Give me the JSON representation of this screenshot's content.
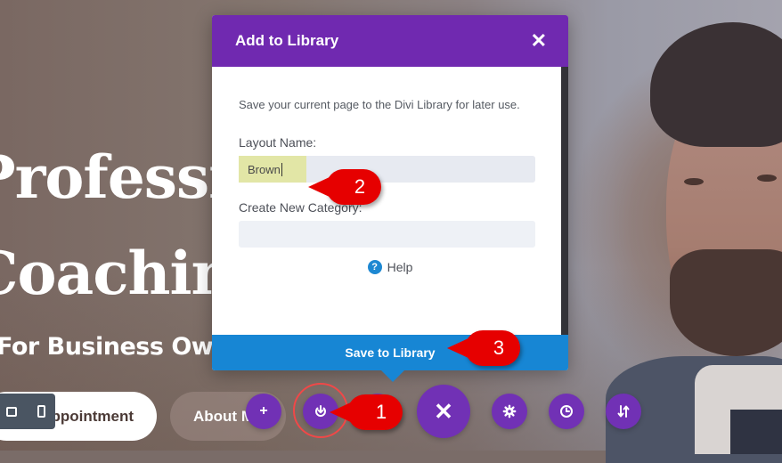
{
  "hero": {
    "title_line1": "Professional",
    "title_line2": "Coaching",
    "subtitle": "For Business Owners",
    "cta_primary": "Book Appointment",
    "cta_secondary": "About Me"
  },
  "device_bar": {
    "icons": [
      "tablet-icon",
      "phone-icon"
    ]
  },
  "modal": {
    "title": "Add to Library",
    "close_icon": "close-icon",
    "description": "Save your current page to the Divi Library for later use.",
    "layout_name_label": "Layout Name:",
    "layout_name_value": "Brown",
    "category_label": "Create New Category:",
    "category_value": "",
    "help_label": "Help",
    "help_icon": "question-icon",
    "save_button": "Save to Library"
  },
  "toolbar": {
    "buttons": [
      {
        "name": "add",
        "icon": "plus-icon",
        "glyph": "+"
      },
      {
        "name": "save",
        "icon": "power-download-icon",
        "glyph": "⏻"
      },
      {
        "name": "close",
        "icon": "close-icon",
        "glyph": "✕"
      },
      {
        "name": "settings",
        "icon": "gear-icon",
        "glyph": "⚙"
      },
      {
        "name": "history",
        "icon": "clock-icon",
        "glyph": "◷"
      },
      {
        "name": "portability",
        "icon": "sort-arrows-icon",
        "glyph": "⇅"
      }
    ]
  },
  "callouts": [
    "1",
    "2",
    "3"
  ],
  "colors": {
    "modal_header": "#7029b0",
    "save_button": "#1786d4",
    "toolbar_button": "#7131b5",
    "callout": "#e60000",
    "input_highlight": "#e2e6a6"
  }
}
